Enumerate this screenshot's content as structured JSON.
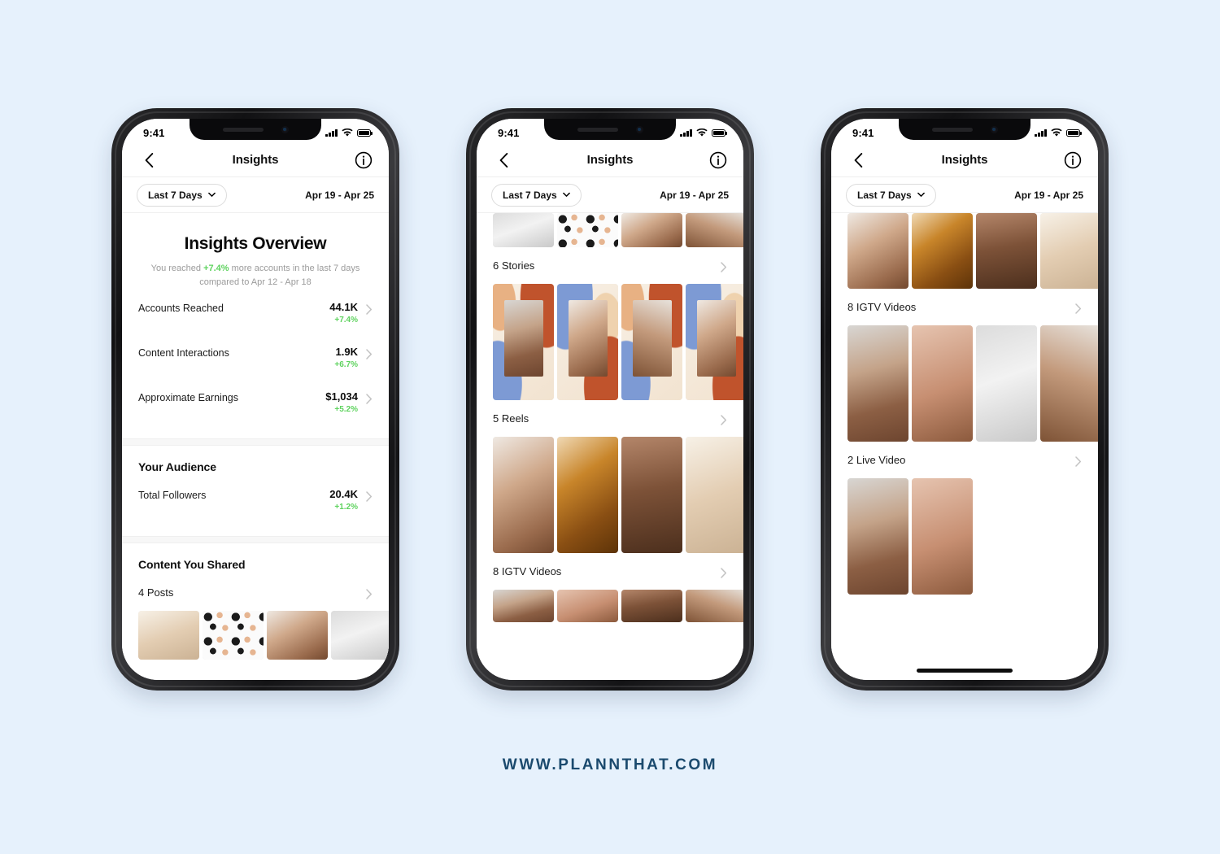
{
  "background_color": "#e6f1fc",
  "accent_positive_color": "#5fd35f",
  "footer": {
    "url": "WWW.PLANNTHAT.COM",
    "color": "#1b4a6e"
  },
  "statusbar": {
    "time": "9:41",
    "icons": [
      "signal-bars-icon",
      "wifi-icon",
      "battery-icon"
    ]
  },
  "navbar": {
    "back_icon": "chevron-left-icon",
    "title": "Insights",
    "info_icon": "info-circle-icon"
  },
  "filter": {
    "range_label": "Last 7 Days",
    "chevron_icon": "chevron-down-icon",
    "date_range": "Apr 19 - Apr 25"
  },
  "phone1": {
    "overview": {
      "title": "Insights Overview",
      "summary_prefix": "You reached ",
      "summary_highlight": "+7.4%",
      "summary_suffix": " more accounts in the last 7 days compared to Apr 12 - Apr 18"
    },
    "metrics": [
      {
        "label": "Accounts Reached",
        "value": "44.1K",
        "delta": "+7.4%"
      },
      {
        "label": "Content Interactions",
        "value": "1.9K",
        "delta": "+6.7%"
      },
      {
        "label": "Approximate Earnings",
        "value": "$1,034",
        "delta": "+5.2%"
      }
    ],
    "audience": {
      "section_title": "Your Audience",
      "metrics": [
        {
          "label": "Total Followers",
          "value": "20.4K",
          "delta": "+1.2%"
        }
      ]
    },
    "content_shared": {
      "section_title": "Content You Shared",
      "rows": [
        {
          "label": "4 Posts"
        }
      ]
    }
  },
  "phone2": {
    "rows": [
      {
        "label": "6 Stories"
      },
      {
        "label": "5 Reels"
      },
      {
        "label": "8 IGTV Videos"
      }
    ]
  },
  "phone3": {
    "rows": [
      {
        "label": "8 IGTV Videos"
      },
      {
        "label": "2 Live Video"
      }
    ]
  }
}
